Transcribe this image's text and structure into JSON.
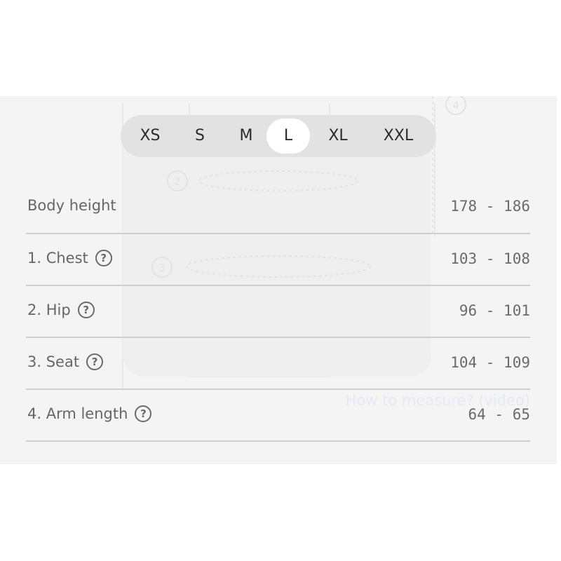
{
  "sizes": {
    "options": [
      "XS",
      "S",
      "M",
      "L",
      "XL",
      "XXL"
    ],
    "selected": "L"
  },
  "illustration": {
    "markers": [
      "2",
      "3",
      "4"
    ]
  },
  "how_to_measure_link": "How to measure? (video)",
  "measurements": [
    {
      "label": "Body height",
      "value": "178 - 186",
      "help": false
    },
    {
      "label": "1. Chest",
      "value": "103 - 108",
      "help": true
    },
    {
      "label": "2. Hip",
      "value": "96 - 101",
      "help": true
    },
    {
      "label": "3. Seat",
      "value": "104 - 109",
      "help": true
    },
    {
      "label": "4. Arm length",
      "value": "64 - 65",
      "help": true
    }
  ],
  "help_icon_glyph": "?"
}
